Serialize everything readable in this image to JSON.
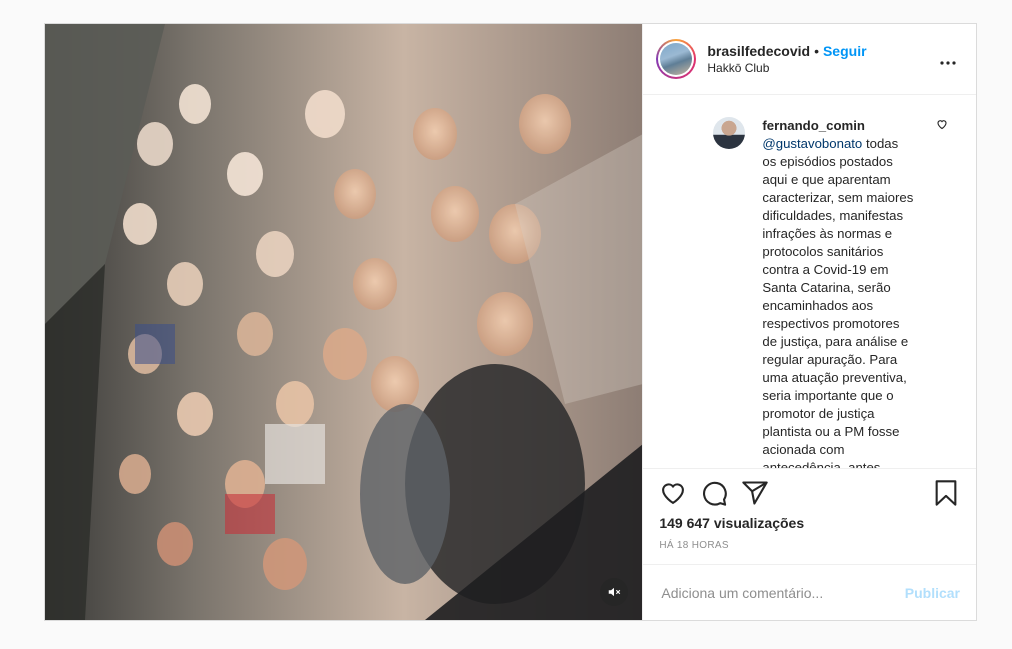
{
  "post": {
    "username": "brasilfedecovid",
    "separator": "•",
    "follow_label": "Seguir",
    "location": "Hakkō Club",
    "more_icon": "more-horizontal-icon"
  },
  "comment": {
    "username": "fernando_comin",
    "mention": "@gustavobonato",
    "text": " todas os episódios postados aqui e que aparentam caracterizar, sem maiores dificuldades, manifestas infrações às normas e protocolos sanitários contra a Covid-19 em Santa Catarina, serão encaminhados aos respectivos promotores de justiça, para análise e regular apuração. Para uma atuação preventiva, seria importante que o promotor de justiça plantista ou a PM fosse acionada com antecedência, antes"
  },
  "actions": {
    "like_icon": "heart-icon",
    "comment_icon": "comment-icon",
    "share_icon": "share-icon",
    "save_icon": "bookmark-icon"
  },
  "stats": {
    "views": "149 647 visualizações",
    "time": "HÁ 18 HORAS"
  },
  "add_comment": {
    "placeholder": "Adiciona um comentário...",
    "publish_label": "Publicar"
  },
  "media": {
    "mute_icon": "volume-muted-icon"
  },
  "colors": {
    "accent": "#0095f6",
    "publish_disabled": "#b2dffc",
    "muted_text": "#8e8e8e",
    "border": "#dbdbdb"
  }
}
